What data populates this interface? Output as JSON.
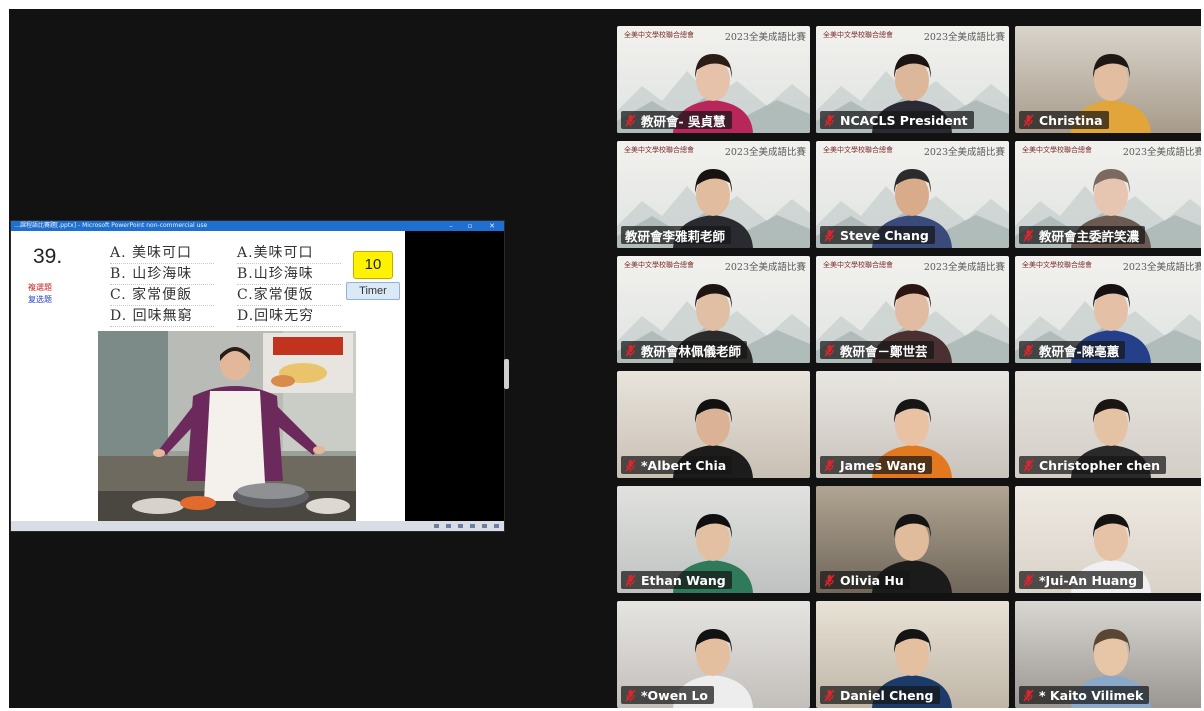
{
  "meeting_view": {
    "shared_window": {
      "title": "…課程語比賽題[.pptx] - Microsoft PowerPoint non-commercial use",
      "window_controls": [
        "–",
        "▫",
        "✕"
      ]
    },
    "slide": {
      "question_number": "39.",
      "note_red": "複選題",
      "note_blue": "复选题",
      "options_traditional": [
        "A. 美味可口",
        "B. 山珍海味",
        "C. 家常便飯",
        "D. 回味無窮"
      ],
      "options_simplified": [
        "A.美味可口",
        "B.山珍海味",
        "C.家常便饭",
        "D.回味无穷"
      ],
      "timer_count": "10",
      "timer_label": "Timer"
    },
    "gallery": {
      "banner_left": "全美中文學校聯合總會",
      "banner_right": "2023全美成語比賽",
      "participants": [
        {
          "name": "教研會- 吳貞慧",
          "muted": true,
          "banner": true,
          "active": false
        },
        {
          "name": "NCACLS President",
          "muted": true,
          "banner": true,
          "active": false
        },
        {
          "name": "Christina",
          "muted": true,
          "banner": false,
          "active": false
        },
        {
          "name": "教研會李雅莉老師",
          "muted": false,
          "banner": true,
          "active": true
        },
        {
          "name": "Steve Chang",
          "muted": true,
          "banner": true,
          "active": false
        },
        {
          "name": "教研會主委許笑濃",
          "muted": true,
          "banner": true,
          "active": false
        },
        {
          "name": "教研會林佩儀老師",
          "muted": true,
          "banner": true,
          "active": false
        },
        {
          "name": "教研會－鄭世芸",
          "muted": true,
          "banner": true,
          "active": false
        },
        {
          "name": "教研會-陳亳蕙",
          "muted": true,
          "banner": true,
          "active": false
        },
        {
          "name": "*Albert Chia",
          "muted": true,
          "banner": false,
          "active": false
        },
        {
          "name": "James Wang",
          "muted": true,
          "banner": false,
          "active": false
        },
        {
          "name": "Christopher chen",
          "muted": true,
          "banner": false,
          "active": false
        },
        {
          "name": "Ethan Wang",
          "muted": true,
          "banner": false,
          "active": false
        },
        {
          "name": "Olivia Hu",
          "muted": true,
          "banner": false,
          "active": false
        },
        {
          "name": "*Jui-An Huang",
          "muted": true,
          "banner": false,
          "active": false
        },
        {
          "name": "*Owen Lo",
          "muted": true,
          "banner": false,
          "active": false
        },
        {
          "name": "Daniel Cheng",
          "muted": true,
          "banner": false,
          "active": false
        },
        {
          "name": "* Kaito Vilimek",
          "muted": true,
          "banner": false,
          "active": false
        }
      ]
    },
    "colors": {
      "stage_bg": "#121212",
      "active_speaker_border": "#36d14a",
      "muted_icon": "#e0242b",
      "titlebar": "#1f6fd1",
      "timer_bg": "#fff200"
    }
  }
}
